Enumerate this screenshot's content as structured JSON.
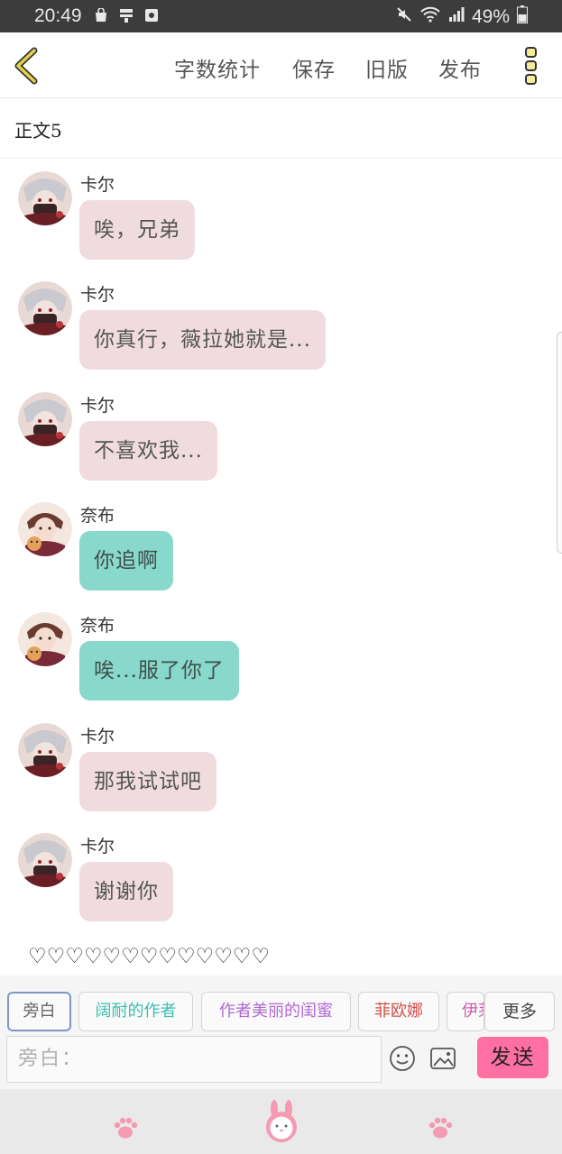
{
  "status_bar": {
    "time": "20:49",
    "battery": "49%"
  },
  "toolbar": {
    "actions": [
      "字数统计",
      "保存",
      "旧版",
      "发布"
    ]
  },
  "chapter_title": "正文5",
  "messages": [
    {
      "name": "卡尔",
      "text": "唉，兄弟",
      "style": "pink",
      "avatar": "karl"
    },
    {
      "name": "卡尔",
      "text": "你真行，薇拉她就是...",
      "style": "pink",
      "avatar": "karl"
    },
    {
      "name": "卡尔",
      "text": "不喜欢我...",
      "style": "pink",
      "avatar": "karl"
    },
    {
      "name": "奈布",
      "text": "你追啊",
      "style": "teal",
      "avatar": "naib"
    },
    {
      "name": "奈布",
      "text": "唉...服了你了",
      "style": "teal",
      "avatar": "naib"
    },
    {
      "name": "卡尔",
      "text": "那我试试吧",
      "style": "pink",
      "avatar": "karl"
    },
    {
      "name": "卡尔",
      "text": "谢谢你",
      "style": "pink",
      "avatar": "karl"
    }
  ],
  "hearts_line": "♡♡♡♡♡♡♡♡♡♡♡♡♡",
  "roles": [
    {
      "label": "旁白",
      "color": "#666666"
    },
    {
      "label": "阔耐的作者",
      "color": "#3bbfae"
    },
    {
      "label": "作者美丽的闺蜜",
      "color": "#b06ad0"
    },
    {
      "label": "菲欧娜",
      "color": "#d0504a"
    },
    {
      "label": "伊莱",
      "color": "#d05aa6"
    }
  ],
  "more_roles_label": "更多",
  "input": {
    "placeholder": "旁白："
  },
  "send_label": "发送",
  "colors": {
    "accent_pink": "#fe6fa2",
    "bubble_pink": "#f0dcdf",
    "bubble_teal": "#88d8cc",
    "back_arrow": "#e6d24a"
  },
  "icons": {
    "back": "chevron-left-icon",
    "more": "vertical-dots-icon",
    "emoji": "smiley-icon",
    "image": "image-icon",
    "nav_left": "paw-icon",
    "nav_center": "bunny-icon",
    "nav_right": "paw-icon"
  }
}
